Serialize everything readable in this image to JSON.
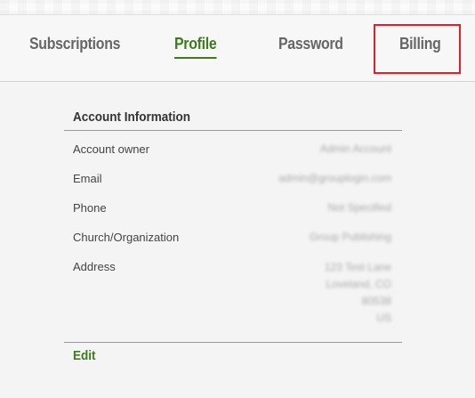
{
  "tabs": {
    "subscriptions": "Subscriptions",
    "profile": "Profile",
    "password": "Password",
    "billing": "Billing",
    "active": "Profile"
  },
  "account": {
    "title": "Account Information",
    "rows": [
      {
        "label": "Account owner",
        "value": "Admin Account"
      },
      {
        "label": "Email",
        "value": "admin@grouplogin.com"
      },
      {
        "label": "Phone",
        "value": "Not Specified"
      },
      {
        "label": "Church/Organization",
        "value": "Group Publishing"
      },
      {
        "label": "Address",
        "value_lines": [
          "123 Test Lane",
          "Loveland, CO",
          "80538",
          "US"
        ]
      }
    ],
    "edit_label": "Edit"
  },
  "colors": {
    "accent": "#3e7a1e",
    "highlight": "#e0202a",
    "tab_inactive": "#666666"
  }
}
